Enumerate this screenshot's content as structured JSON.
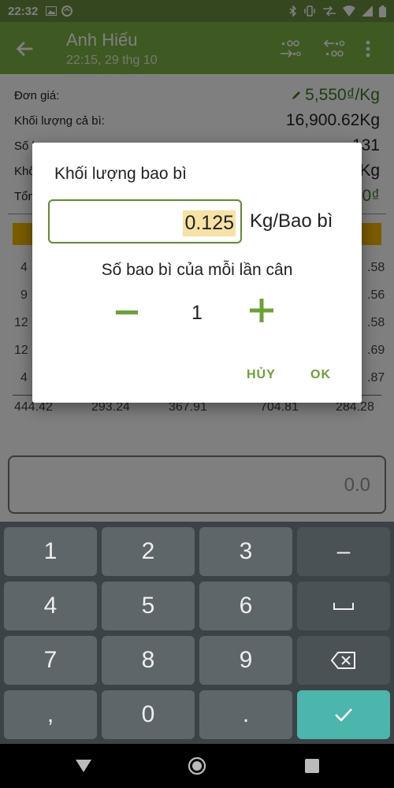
{
  "status_bar": {
    "time": "22:32"
  },
  "app_bar": {
    "title": "Anh Hiếu",
    "subtitle": "22:15, 29 thg 10"
  },
  "summary": {
    "unit_price_label": "Đơn giá:",
    "unit_price_value": "5,550₫/Kg",
    "gross_weight_label": "Khối lượng cả bì:",
    "gross_weight_value": "16,900.62Kg",
    "row3_label": "Số l",
    "row3_value": "131",
    "row4_label": "Khố",
    "row4_value": "Kg",
    "row5_label": "Tổn",
    "row5_value": "0₫"
  },
  "grid": {
    "rows": [
      [
        "4",
        "",
        "",
        "",
        ".58"
      ],
      [
        "9",
        "",
        "",
        "",
        ".56"
      ],
      [
        "12",
        "",
        "",
        "",
        ".58"
      ],
      [
        "12",
        "",
        "",
        "",
        ".69"
      ],
      [
        "4",
        "",
        "",
        "",
        ".87"
      ]
    ],
    "totals": [
      "444.42",
      "293.24",
      "367.91",
      "704.81",
      "284.28"
    ]
  },
  "weight_input": {
    "value": "0.0"
  },
  "keyboard": {
    "k1": "1",
    "k2": "2",
    "k3": "3",
    "minus": "–",
    "k4": "4",
    "k5": "5",
    "k6": "6",
    "k7": "7",
    "k8": "8",
    "k9": "9",
    "comma": ",",
    "k0": "0",
    "dot": "."
  },
  "dialog": {
    "title": "Khối lượng bao bì",
    "package_weight_value": "0.125",
    "unit": "Kg/Bao bì",
    "per_weighing_label": "Số bao bì của mỗi lần cân",
    "stepper_value": "1",
    "cancel_label": "HỦY",
    "ok_label": "OK"
  },
  "colors": {
    "app_bar": "#7cb342",
    "accent_green": "#6aa334",
    "input_highlight": "#f7e2a6",
    "keyboard_ok": "#4db6ac"
  },
  "icons": {
    "back": "arrow-left-icon",
    "toolbar_a": "decimal-increase-icon",
    "toolbar_b": "decimal-decrease-icon",
    "more": "more-vert-icon",
    "edit": "pencil-icon",
    "backspace": "backspace-icon",
    "space": "space-icon",
    "done": "check-icon"
  }
}
